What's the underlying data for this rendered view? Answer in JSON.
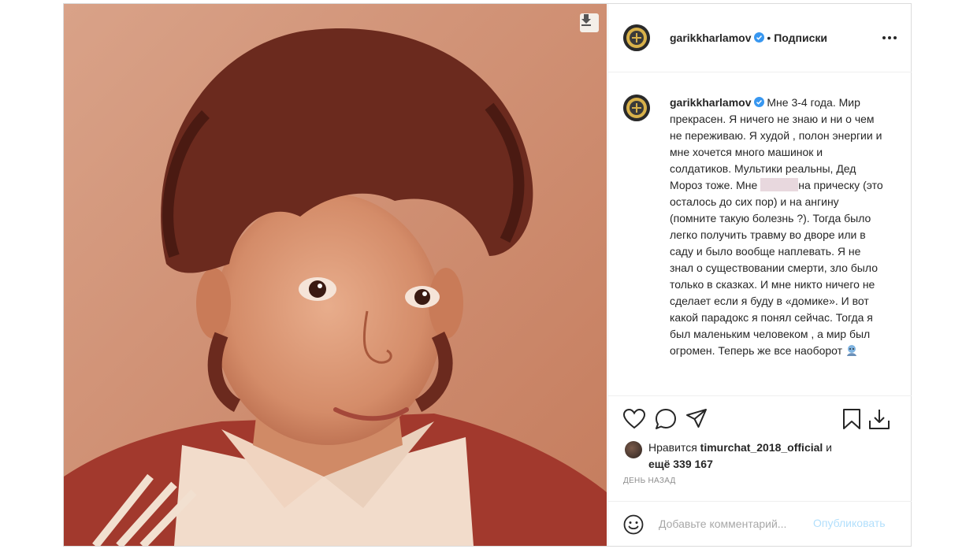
{
  "post": {
    "author": "garikkharlamov",
    "follow_sep": " • ",
    "follow_label": "Подписки",
    "caption": {
      "before_redact": "Мне 3-4 года. Мир прекрасен. Я ничего не знаю и ни о чем не переживаю. Я худой , полон энергии и мне хочется много машинок и солдатиков. Мультики реальны, Дед Мороз тоже. Мне ",
      "after_redact": "на прическу (это осталось до сих пор) и на ангину (помните такую болезнь ?). Тогда было легко получить травму во дворе или в саду и было вообще наплевать. Я не знал о существовании смерти, зло было только в сказках. И мне никто ничего не сделает если я буду в «домике». И вот какой парадокс я понял сейчас. Тогда я был маленьким человеком , а мир был огромен. Теперь же все наоборот "
    },
    "likes": {
      "prefix": "Нравится ",
      "user": "timurchat_2018_official",
      "joiner": " и",
      "rest": "ещё 339 167"
    },
    "time": "день назад",
    "comment": {
      "placeholder": "Добавьте комментарий...",
      "publish": "Опубликовать"
    }
  },
  "colors": {
    "verified": "#3897f0",
    "publish_disabled": "#b2dffc",
    "muted": "#8e8e8e"
  },
  "icons": [
    "download-icon",
    "verified-icon",
    "more-icon",
    "heart-icon",
    "comment-icon",
    "share-icon",
    "bookmark-icon",
    "save-download-icon",
    "smile-icon",
    "emoji-icon"
  ]
}
